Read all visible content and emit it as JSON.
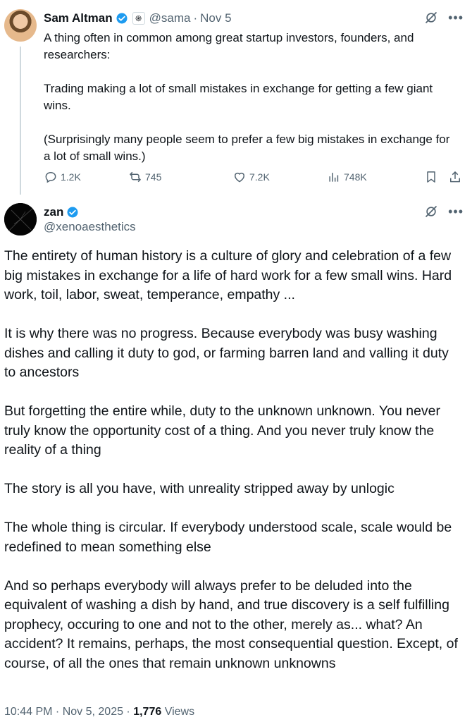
{
  "parent_tweet": {
    "author_name": "Sam Altman",
    "handle": "@sama",
    "separator": "·",
    "date": "Nov 5",
    "paragraphs": [
      "A thing often in common among great startup investors, founders, and researchers:",
      "Trading making a lot of small mistakes in exchange for getting a few giant wins.",
      "(Surprisingly many people seem to prefer a few big mistakes in exchange for a lot of small wins.)"
    ],
    "replies": "1.2K",
    "reposts": "745",
    "likes": "7.2K",
    "views": "748K"
  },
  "reply_tweet": {
    "author_name": "zan",
    "handle": "@xenoaesthetics",
    "paragraphs": [
      "The entirety of human history is a culture of glory and celebration of a few big mistakes in exchange for a life of hard work for a few small wins. Hard work, toil, labor, sweat, temperance, empathy ...",
      "It is why there was no progress. Because everybody was busy washing dishes and calling it duty to god, or farming barren land and valling it duty to ancestors",
      "But forgetting the entire while, duty to the unknown unknown. You never truly know the opportunity cost of a thing. And you never truly know the reality of a thing",
      "The story is all you have, with unreality stripped away by unlogic",
      "The whole thing is circular. If everybody understood scale, scale would be redefined to mean something else",
      "And so perhaps everybody will always prefer to be deluded into the equivalent of washing a dish by hand, and true discovery is a self fulfilling prophecy, occuring to one and not to the other, merely as... what? An accident? It remains, perhaps, the most consequential question. Except, of course, of all the ones that remain unknown unknowns"
    ],
    "timestamp": "10:44 PM · Nov 5, 2025 · ",
    "views_count": "1,776",
    "views_label": "Views"
  },
  "icons": {
    "verified": "verified-badge-icon",
    "affiliate": "openai-affiliate-icon",
    "grok": "grok-icon",
    "more": "more-icon",
    "reply": "reply-icon",
    "repost": "repost-icon",
    "like": "like-icon",
    "views": "views-icon",
    "bookmark": "bookmark-icon",
    "share": "share-icon"
  },
  "colors": {
    "accent": "#1d9bf0",
    "text": "#0f1419",
    "secondary": "#536471",
    "thread_line": "#cfd9de"
  }
}
